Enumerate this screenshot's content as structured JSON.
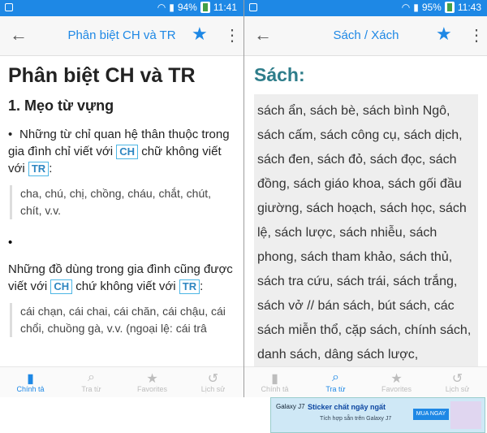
{
  "left": {
    "status": {
      "battery": "94%",
      "time": "11:41"
    },
    "appbar": {
      "title": "Phân biệt CH và TR"
    },
    "content": {
      "heading": "Phân biệt CH và TR",
      "subheading": "1. Mẹo từ vựng",
      "p1_pre": "Những từ chỉ quan hệ thân thuộc trong gia đình chỉ viết với ",
      "tag_ch": "CH",
      "p1_mid": " chữ không viết với ",
      "tag_tr": "TR",
      "p1_post": ":",
      "quote1": "cha, chú, chị, chồng, cháu, chắt, chút, chít, v.v.",
      "bullet2": "•",
      "p2_pre": "Những đồ dùng trong gia đình cũng được viết với ",
      "p2_mid": " chứ không viết với ",
      "p2_post": ":",
      "quote2": "cái chạn, cái chai, cái chăn, cái chậu, cái chổi, chuồng gà, v.v. (ngoại lệ: cái trâ"
    }
  },
  "right": {
    "status": {
      "battery": "95%",
      "time": "11:43"
    },
    "appbar": {
      "title": "Sách / Xách"
    },
    "content": {
      "heading": "Sách:",
      "body": "sách ẩn, sách bè, sách bình Ngô, sách cấm, sách công cụ, sách dịch, sách đen, sách đỏ, sách đọc, sách đồng, sách giáo khoa, sách gối đầu giường, sách hoạch, sách học, sách lệ, sách lược, sách nhiễu, sách phong, sách tham khảo, sách thủ, sách tra cứu, sách trái, sách trắng, sách vở // bán sách, bút sách, các sách miễn thổ, cặp sách, chính sách, danh sách, dâng sách lược,"
    }
  },
  "nav": [
    {
      "label": "Chính tả",
      "icon": "book-icon"
    },
    {
      "label": "Tra từ",
      "icon": "search-icon"
    },
    {
      "label": "Favorites",
      "icon": "star-icon"
    },
    {
      "label": "Lịch sử",
      "icon": "history-icon"
    }
  ],
  "ad": {
    "brand": "Galaxy J7",
    "headline": "Sticker chất ngây ngất",
    "sub": "Tích hợp sẵn trên Galaxy J7",
    "button": "MUA NGAY"
  },
  "colors": {
    "accent": "#1e88e5",
    "heading_teal": "#2e7d8a"
  }
}
